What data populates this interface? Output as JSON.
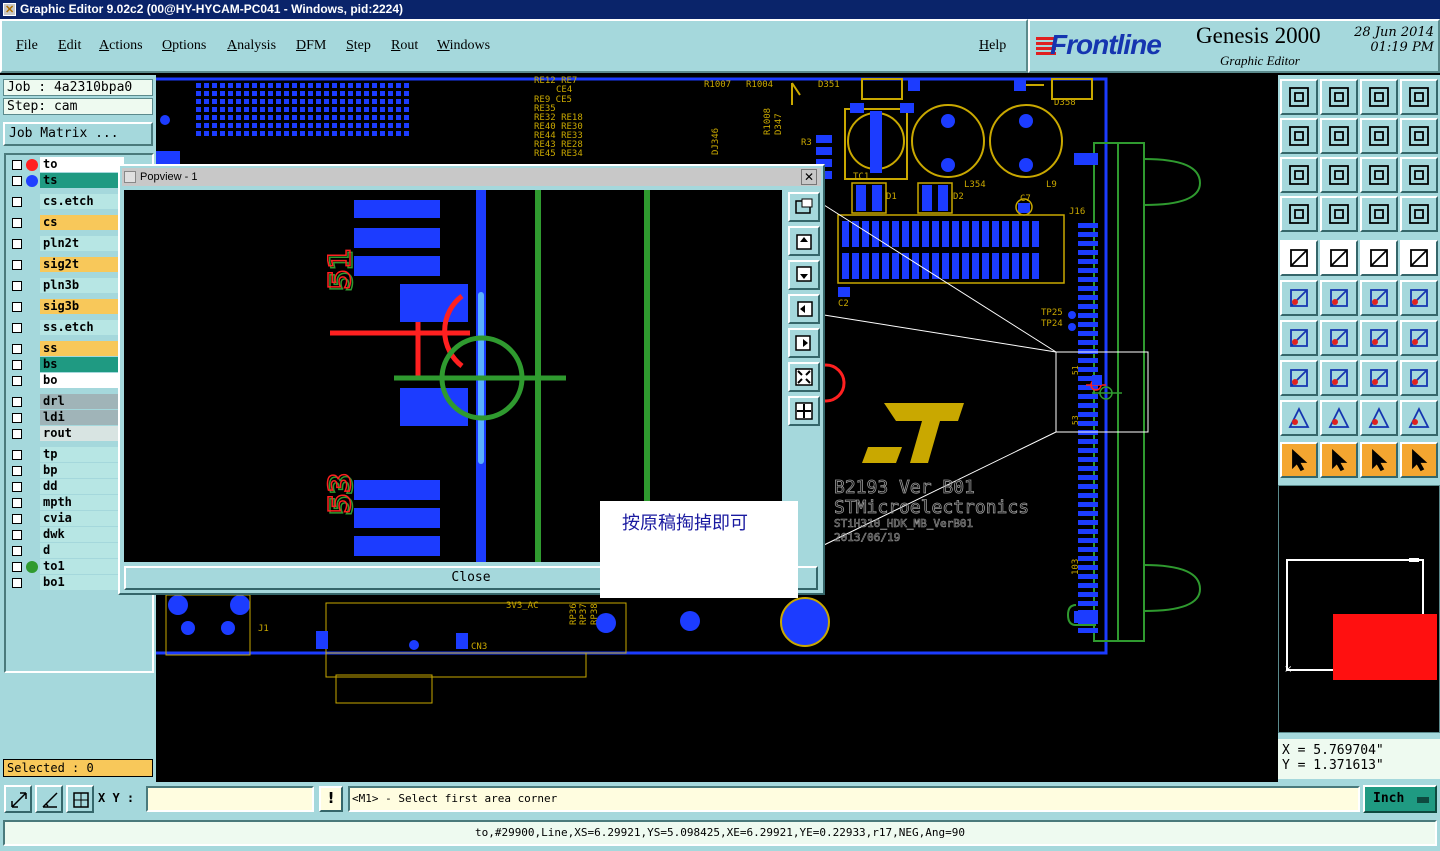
{
  "window": {
    "title": "Graphic Editor 9.02c2 (00@HY-HYCAM-PC041 - Windows, pid:2224)"
  },
  "menu": {
    "items": [
      "File",
      "Edit",
      "Actions",
      "Options",
      "Analysis",
      "DFM",
      "Step",
      "Rout",
      "Windows"
    ],
    "help": "Help"
  },
  "brand": {
    "logo": "Frontline",
    "product": "Genesis 2000",
    "subtitle": "Graphic Editor",
    "date": "28 Jun 2014",
    "time": "01:19 PM"
  },
  "job": {
    "job_label": "Job : 4a2310bpa0",
    "step_label": "Step: cam",
    "matrix_button": "Job Matrix ..."
  },
  "layers": [
    {
      "name": "to",
      "color": "#ffffff",
      "dot": "#ff2020"
    },
    {
      "name": "ts",
      "color": "#1f9a82",
      "dot": "#2040ff"
    },
    {
      "name": "cs.etch",
      "color": "#b7e6e4",
      "dot": ""
    },
    {
      "name": "cs",
      "color": "#f8c85a",
      "dot": ""
    },
    {
      "name": "pln2t",
      "color": "#b7e6e4",
      "dot": ""
    },
    {
      "name": "sig2t",
      "color": "#f8c85a",
      "dot": ""
    },
    {
      "name": "pln3b",
      "color": "#b7e6e4",
      "dot": ""
    },
    {
      "name": "sig3b",
      "color": "#f8c85a",
      "dot": ""
    },
    {
      "name": "ss.etch",
      "color": "#b7e6e4",
      "dot": ""
    },
    {
      "name": "ss",
      "color": "#f8c85a",
      "dot": ""
    },
    {
      "name": "bs",
      "color": "#1f9a82",
      "dot": ""
    },
    {
      "name": "bo",
      "color": "#ffffff",
      "dot": ""
    },
    {
      "name": "drl",
      "color": "#a0b4b8",
      "dot": ""
    },
    {
      "name": "ldi",
      "color": "#a0b4b8",
      "dot": ""
    },
    {
      "name": "rout",
      "color": "#d8e4e2",
      "dot": ""
    },
    {
      "name": "tp",
      "color": "#b7e6e4",
      "dot": ""
    },
    {
      "name": "bp",
      "color": "#b7e6e4",
      "dot": ""
    },
    {
      "name": "dd",
      "color": "#b7e6e4",
      "dot": ""
    },
    {
      "name": "mpth",
      "color": "#b7e6e4",
      "dot": ""
    },
    {
      "name": "cvia",
      "color": "#b7e6e4",
      "dot": ""
    },
    {
      "name": "dwk",
      "color": "#b7e6e4",
      "dot": ""
    },
    {
      "name": "d",
      "color": "#b7e6e4",
      "dot": ""
    },
    {
      "name": "to1",
      "color": "#b7e6e4",
      "dot": "#2f9a2f"
    },
    {
      "name": "bo1",
      "color": "#b7e6e4",
      "dot": ""
    }
  ],
  "selected": "Selected : 0",
  "popview": {
    "title": "Popview - 1",
    "close_label": "Close",
    "labels": [
      "51",
      "53"
    ]
  },
  "board": {
    "designators": [
      "RE12 RE7",
      "CE4",
      "RE9  CE5",
      "RE35",
      "RE32 RE18",
      "RE40 RE30",
      "RE44 RE33",
      "RE43 RE28",
      "RE45 RE34",
      "R1007",
      "R1004",
      "D351",
      "D358",
      "R3",
      "TC1",
      "L354",
      "L9",
      "D1",
      "D2",
      "C7",
      "J16",
      "C2",
      "TP25",
      "TP24",
      "51",
      "53",
      "3V3_AC",
      "J1",
      "CN3",
      "RP36",
      "RP37",
      "RP38",
      "103"
    ],
    "silkscreen": [
      "B2193 Ver B01",
      "STMicroelectronics",
      "STiH310_HDK_MB_VerB01",
      "2013/06/19"
    ]
  },
  "note": "按原稿掏掉即可",
  "coords": {
    "x": "X = 5.769704\"",
    "y": "Y = 1.371613\""
  },
  "input": {
    "xy_label": "X Y :",
    "xy_value": "",
    "prompt": "<M1> - Select first area corner",
    "unit": "Inch"
  },
  "status": "to,#29900,Line,XS=6.29921,YS=5.098425,XE=6.29921,YE=0.22933,r17,NEG,Ang=90"
}
